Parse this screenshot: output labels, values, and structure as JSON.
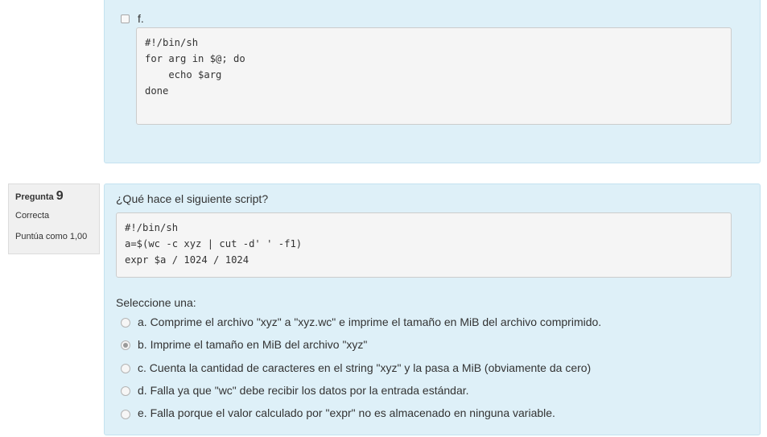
{
  "prev_question": {
    "option_f_label": "f.",
    "option_f_code": "#!/bin/sh\nfor arg in $@; do\n    echo $arg\ndone"
  },
  "question": {
    "label": "Pregunta",
    "number": "9",
    "status": "Correcta",
    "grade": "Puntúa como 1,00",
    "prompt": "¿Qué hace el siguiente script?",
    "code": "#!/bin/sh\na=$(wc -c xyz | cut -d' ' -f1)\nexpr $a / 1024 / 1024",
    "select_prompt": "Seleccione una:",
    "options": [
      {
        "label": "a. Comprime el archivo \"xyz\" a \"xyz.wc\" e imprime el tamaño en MiB del archivo comprimido.",
        "selected": false
      },
      {
        "label": "b. Imprime el tamaño en MiB del archivo \"xyz\"",
        "selected": true
      },
      {
        "label": "c. Cuenta la cantidad de caracteres en el string \"xyz\" y la pasa a MiB (obviamente da cero)",
        "selected": false
      },
      {
        "label": "d. Falla ya que \"wc\" debe recibir los datos por la entrada estándar.",
        "selected": false
      },
      {
        "label": "e. Falla porque el valor calculado por \"expr\" no es almacenado en ninguna variable.",
        "selected": false
      }
    ]
  }
}
